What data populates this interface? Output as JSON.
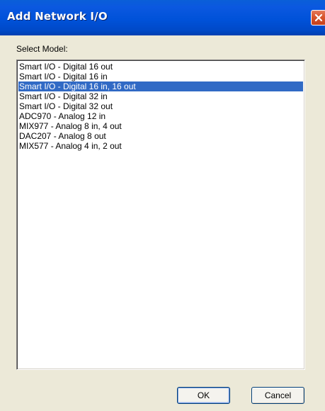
{
  "window": {
    "title": "Add Network I/O",
    "close_icon": "close-icon"
  },
  "model_select": {
    "label": "Select Model:",
    "selected_index": 2,
    "items": [
      {
        "label": "Smart I/O - Digital 16 out"
      },
      {
        "label": "Smart I/O - Digital 16 in"
      },
      {
        "label": "Smart I/O - Digital 16 in, 16 out"
      },
      {
        "label": "Smart I/O - Digital 32 in"
      },
      {
        "label": "Smart I/O - Digital 32 out"
      },
      {
        "label": "ADC970 - Analog 12 in"
      },
      {
        "label": "MIX977 - Analog 8 in, 4 out"
      },
      {
        "label": "DAC207 - Analog 8 out"
      },
      {
        "label": "MIX577 - Analog 4 in, 2 out"
      }
    ]
  },
  "buttons": {
    "ok_label": "OK",
    "cancel_label": "Cancel"
  },
  "colors": {
    "titlebar": "#0052d9",
    "selection": "#316ac5",
    "dialog_bg": "#ece9d8",
    "close_button": "#d9552d"
  }
}
